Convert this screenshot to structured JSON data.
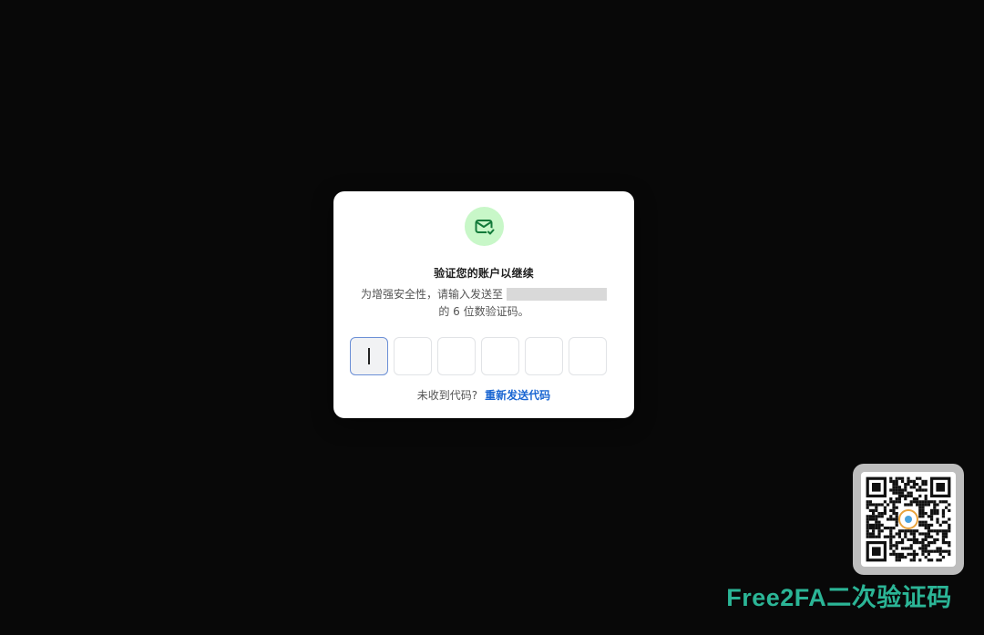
{
  "dialog": {
    "icon": "envelope-check-icon",
    "title": "验证您的账户以继续",
    "description_line1": "为增强安全性，请输入发送至",
    "description_line2": "的 6 位数验证码。",
    "code_digits": [
      "",
      "",
      "",
      "",
      "",
      ""
    ],
    "resend_prompt": "未收到代码?",
    "resend_link": "重新发送代码"
  },
  "watermark": {
    "qr": "qr-code",
    "brand_text": "Free2FA二次验证码"
  },
  "colors": {
    "background": "#080808",
    "icon_bg": "#c8f7c8",
    "icon_fg": "#137a3a",
    "link": "#1a66d2",
    "brand": "#2bb596"
  }
}
